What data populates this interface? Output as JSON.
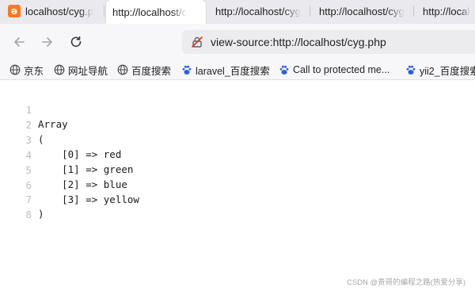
{
  "tabs": [
    {
      "title": "localhost/cyg.p",
      "favicon": "xampp-icon",
      "active": false
    },
    {
      "title": "http://localhost/c",
      "favicon": "",
      "active": true
    },
    {
      "title": "http://localhost/cyg",
      "favicon": "",
      "active": false
    },
    {
      "title": "http://localhost/cyg",
      "favicon": "",
      "active": false
    },
    {
      "title": "http://localhost",
      "favicon": "",
      "active": false
    }
  ],
  "toolbar": {
    "back_icon": "arrow-left-icon",
    "forward_icon": "arrow-right-icon",
    "reload_icon": "reload-icon",
    "address": "view-source:http://localhost/cyg.php",
    "security_icon": "insecure-lock-icon"
  },
  "bookmarks": [
    {
      "label": "京东",
      "icon": "globe-icon"
    },
    {
      "label": "网址导航",
      "icon": "globe-icon"
    },
    {
      "label": "百度搜索",
      "icon": "globe-icon"
    },
    {
      "label": "laravel_百度搜索",
      "icon": "baidu-paw-icon"
    },
    {
      "label": "Call to protected me...",
      "icon": "baidu-paw-icon"
    },
    {
      "label": "yii2_百度搜索",
      "icon": "baidu-paw-icon"
    }
  ],
  "source": {
    "lines": [
      {
        "no": "1",
        "text": "Array"
      },
      {
        "no": "2",
        "text": "("
      },
      {
        "no": "3",
        "text": "    [0] => red"
      },
      {
        "no": "4",
        "text": "    [1] => green"
      },
      {
        "no": "5",
        "text": "    [2] => blue"
      },
      {
        "no": "6",
        "text": "    [3] => yellow"
      },
      {
        "no": "7",
        "text": ")"
      },
      {
        "no": "8",
        "text": ""
      }
    ]
  },
  "watermark": "CSDN @贵哥的编程之路(热爱分享)",
  "colors": {
    "tabstrip": "#e9e9ee",
    "toolbar": "#f7f7f9",
    "urlbar": "#ececef",
    "line_number": "#bdbdbd",
    "baidu_blue": "#2f5fd9",
    "insecure_red": "#d93025",
    "xampp_orange": "#fb7a24"
  }
}
